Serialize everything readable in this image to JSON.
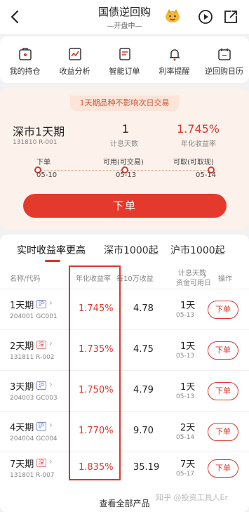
{
  "header": {
    "title": "国债逆回购",
    "subtitle": "—开盘中—"
  },
  "shortcuts": [
    {
      "label": "我的持仓",
      "icon": "portfolio-icon"
    },
    {
      "label": "收益分析",
      "icon": "chart-icon"
    },
    {
      "label": "智能订单",
      "icon": "order-icon"
    },
    {
      "label": "利率提醒",
      "icon": "bell-icon"
    },
    {
      "label": "逆回购日历",
      "icon": "calendar-icon"
    }
  ],
  "product": {
    "notice": "1天期品种不影响次日交易",
    "name": "深市1天期",
    "code": "131810 R-001",
    "days": "1",
    "days_label": "计息天数",
    "rate": "1.745%",
    "rate_label": "年化收益率",
    "timeline": [
      {
        "label": "下单",
        "date": "05-10"
      },
      {
        "label": "可用(可交易)",
        "date": "05-13"
      },
      {
        "label": "可取(可取现)",
        "date": "05-14"
      }
    ],
    "order_button": "下单"
  },
  "tabs": [
    "实时收益率更高",
    "深市1000起",
    "沪市1000起"
  ],
  "columns": {
    "name": "名称/代码",
    "rate": "年化收益率",
    "income": "每10万收益",
    "days_top": "计息天数",
    "days_bottom": "资金可用日",
    "chevron": "›",
    "action": "操作"
  },
  "rows": [
    {
      "name": "1天期",
      "tag": "沪",
      "code": "204001 GC001",
      "rate": "1.745%",
      "income": "4.78",
      "days": "1天",
      "date": "05-13",
      "action": "下单"
    },
    {
      "name": "2天期",
      "tag": "深",
      "code": "131811 R-002",
      "rate": "1.735%",
      "income": "4.75",
      "days": "1天",
      "date": "05-13",
      "action": "下单"
    },
    {
      "name": "3天期",
      "tag": "沪",
      "code": "204003 GC003",
      "rate": "1.750%",
      "income": "4.79",
      "days": "1天",
      "date": "05-13",
      "action": "下单"
    },
    {
      "name": "4天期",
      "tag": "沪",
      "code": "204004 GC004",
      "rate": "1.770%",
      "income": "9.70",
      "days": "2天",
      "date": "05-14",
      "action": "下单"
    },
    {
      "name": "7天期",
      "tag": "深",
      "code": "131801 R-007",
      "rate": "1.835%",
      "income": "35.19",
      "days": "7天",
      "date": "05-17",
      "action": "下单"
    }
  ],
  "footer": {
    "view_all": "查看全部产品",
    "watermark": "知乎 @投资工具人Er"
  },
  "colors": {
    "accent": "#e0352b",
    "card_bg": "#fdf1eb"
  }
}
